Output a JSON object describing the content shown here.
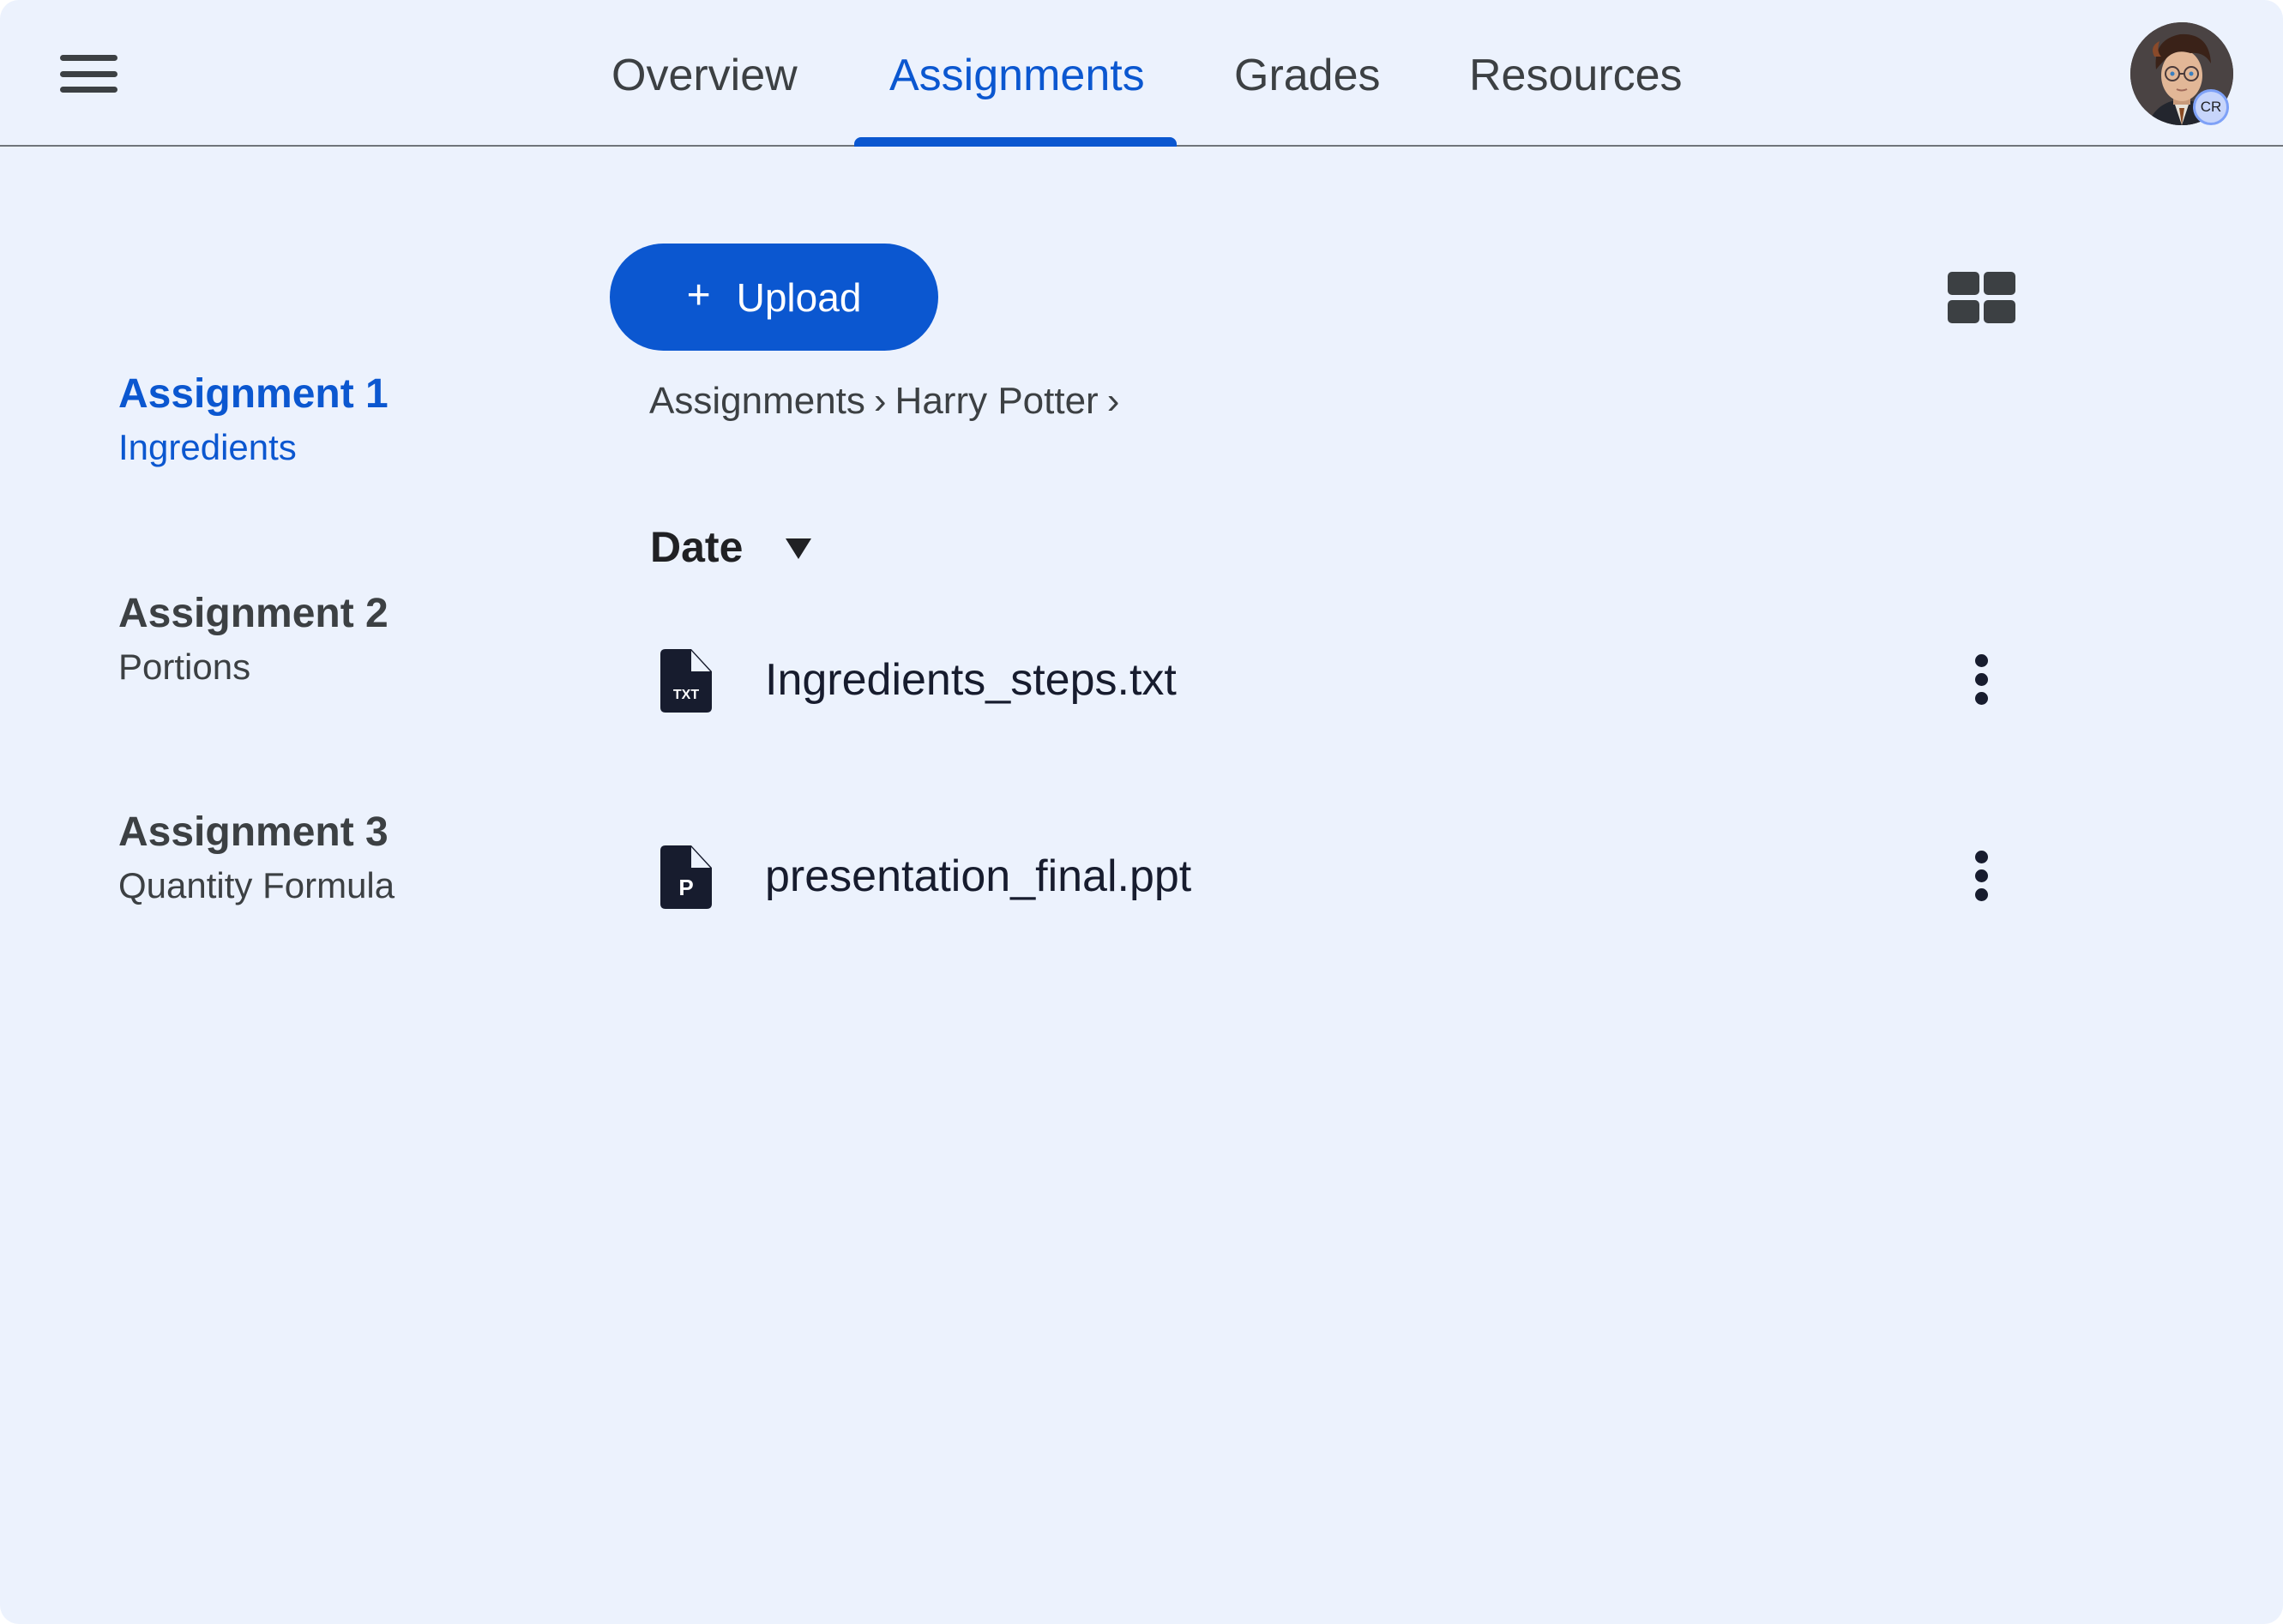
{
  "nav": {
    "menu_icon": "hamburger-menu-icon",
    "tabs": [
      {
        "label": "Overview",
        "active": false
      },
      {
        "label": "Assignments",
        "active": true
      },
      {
        "label": "Grades",
        "active": false
      },
      {
        "label": "Resources",
        "active": false
      }
    ],
    "avatar": {
      "badge_text": "CR",
      "alt": "Harry Potter avatar"
    }
  },
  "sidebar": {
    "items": [
      {
        "title": "Assignment 1",
        "subtitle": "Ingredients",
        "active": true
      },
      {
        "title": "Assignment 2",
        "subtitle": "Portions",
        "active": false
      },
      {
        "title": "Assignment 3",
        "subtitle": "Quantity Formula",
        "active": false
      }
    ]
  },
  "toolbar": {
    "upload_icon": "+",
    "upload_label": "Upload",
    "view_toggle_icon": "grid-view-icon"
  },
  "breadcrumb": {
    "items": [
      "Assignments",
      "Harry Potter"
    ],
    "separator": "›"
  },
  "sort": {
    "label": "Date",
    "icon": "dropdown-caret-icon"
  },
  "files": [
    {
      "name": "Ingredients_steps.txt",
      "type_label": "TXT",
      "icon": "txt-file-icon"
    },
    {
      "name": "presentation_final.ppt",
      "type_label": "P",
      "icon": "ppt-file-icon"
    }
  ],
  "colors": {
    "accent": "#0b57d0",
    "background": "#ecf2fd",
    "text": "#3c4043",
    "icon_dark": "#171c2e"
  }
}
